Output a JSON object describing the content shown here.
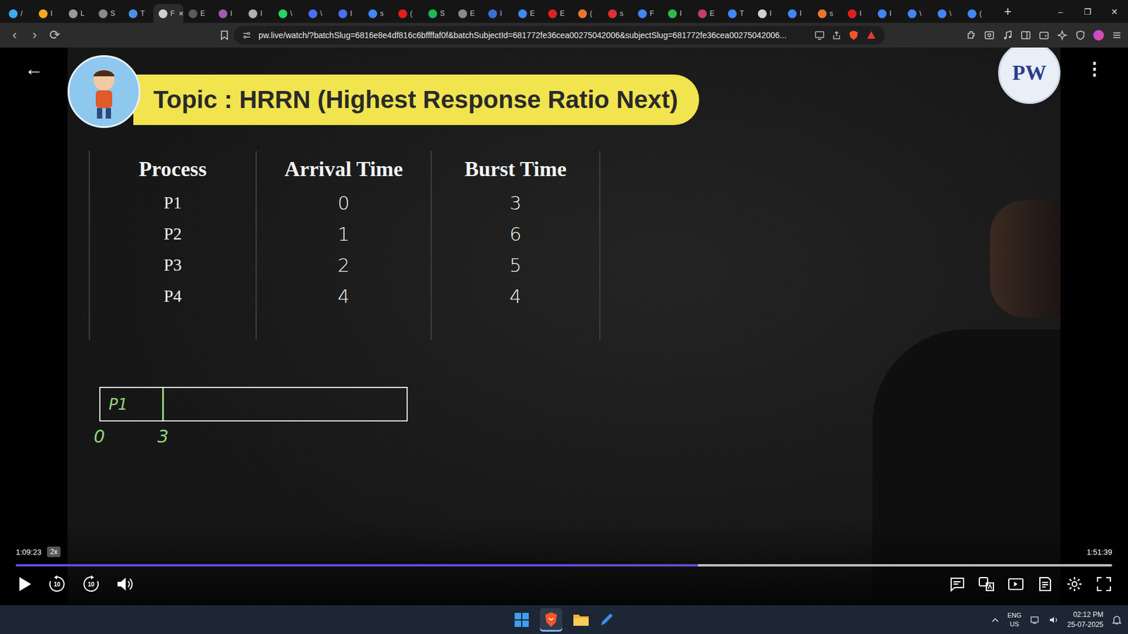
{
  "browser": {
    "tabs": [
      {
        "label": "/",
        "selected": false,
        "color": "#3fa9f5"
      },
      {
        "label": "I",
        "selected": false,
        "color": "#f5a623"
      },
      {
        "label": "L",
        "selected": false,
        "color": "#9a9a9a"
      },
      {
        "label": "S",
        "selected": false,
        "color": "#8a8a8a"
      },
      {
        "label": "T",
        "selected": false,
        "color": "#4a90e2"
      },
      {
        "label": "F",
        "selected": true,
        "color": "#d0d0d0"
      },
      {
        "label": "E",
        "selected": false,
        "color": "#5a5a5a"
      },
      {
        "label": "I",
        "selected": false,
        "color": "#a05ab0"
      },
      {
        "label": "I",
        "selected": false,
        "color": "#b0b0b0"
      },
      {
        "label": "\\",
        "selected": false,
        "color": "#25d366"
      },
      {
        "label": "\\",
        "selected": false,
        "color": "#4b6ef5"
      },
      {
        "label": "I",
        "selected": false,
        "color": "#4b6ef5"
      },
      {
        "label": "s",
        "selected": false,
        "color": "#4285f4"
      },
      {
        "label": "(",
        "selected": false,
        "color": "#e02020"
      },
      {
        "label": "S",
        "selected": false,
        "color": "#1db954"
      },
      {
        "label": "E",
        "selected": false,
        "color": "#8a8a8a"
      },
      {
        "label": "I",
        "selected": false,
        "color": "#3b6fd6"
      },
      {
        "label": "E",
        "selected": false,
        "color": "#4285f4"
      },
      {
        "label": "E",
        "selected": false,
        "color": "#e02020"
      },
      {
        "label": "(",
        "selected": false,
        "color": "#e8762b"
      },
      {
        "label": "s",
        "selected": false,
        "color": "#e03030"
      },
      {
        "label": "F",
        "selected": false,
        "color": "#4285f4"
      },
      {
        "label": "I",
        "selected": false,
        "color": "#2fb84a"
      },
      {
        "label": "E",
        "selected": false,
        "color": "#c04060"
      },
      {
        "label": "T",
        "selected": false,
        "color": "#4285f4"
      },
      {
        "label": "I",
        "selected": false,
        "color": "#d0d0d0"
      },
      {
        "label": "I",
        "selected": false,
        "color": "#4285f4"
      },
      {
        "label": "s",
        "selected": false,
        "color": "#e8762b"
      },
      {
        "label": "I",
        "selected": false,
        "color": "#e02020"
      },
      {
        "label": "I",
        "selected": false,
        "color": "#4285f4"
      },
      {
        "label": "\\",
        "selected": false,
        "color": "#4285f4"
      },
      {
        "label": "\\",
        "selected": false,
        "color": "#4285f4"
      },
      {
        "label": "(",
        "selected": false,
        "color": "#4285f4"
      }
    ],
    "tab_close": "×",
    "new_tab": "+",
    "window_controls": [
      "–",
      "❐",
      "✕"
    ],
    "nav": [
      "‹",
      "›",
      "⟳"
    ],
    "url": "pw.live/watch/?batchSlug=6816e8e4df816c6bffffaf0f&batchSubjectId=681772fe36cea00275042006&subjectSlug=681772fe36cea00275042006..."
  },
  "slide": {
    "title": "Topic : HRRN (Highest Response Ratio Next)",
    "logo": "PW",
    "table": {
      "columns": [
        "Process",
        "Arrival Time",
        "Burst Time"
      ],
      "rows": [
        [
          "P1",
          "0",
          "3"
        ],
        [
          "P2",
          "1",
          "6"
        ],
        [
          "P3",
          "2",
          "5"
        ],
        [
          "P4",
          "4",
          "4"
        ]
      ]
    },
    "gantt": {
      "start": "0",
      "segments": [
        {
          "label": "P1",
          "from": "0",
          "to": "3"
        }
      ]
    }
  },
  "player": {
    "back": "←",
    "menu": "⋮",
    "current": "1:09:23",
    "speed": "2x",
    "duration": "1:51:39",
    "level": 0.622,
    "skip_back": "10",
    "skip_forward": "10"
  },
  "taskbar": {
    "lang": "ENG",
    "region": "US",
    "time": "02:12 PM",
    "date": "25-07-2025"
  }
}
